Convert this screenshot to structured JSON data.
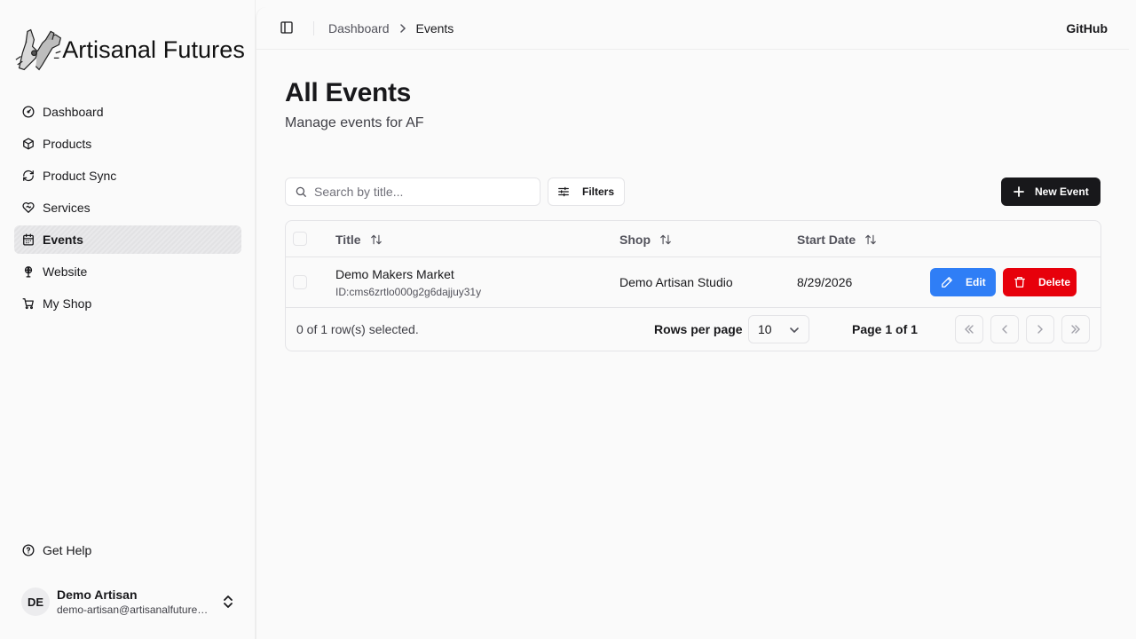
{
  "app": {
    "brand": "Artisanal Futures"
  },
  "sidebar": {
    "items": [
      {
        "label": "Dashboard",
        "icon": "gauge-icon"
      },
      {
        "label": "Products",
        "icon": "package-icon"
      },
      {
        "label": "Product Sync",
        "icon": "refresh-icon"
      },
      {
        "label": "Services",
        "icon": "heart-handshake-icon"
      },
      {
        "label": "Events",
        "icon": "calendar-icon",
        "active": true
      },
      {
        "label": "Website",
        "icon": "globe-pin-icon"
      },
      {
        "label": "My Shop",
        "icon": "cart-icon"
      }
    ],
    "help": {
      "label": "Get Help",
      "icon": "help-circle-icon"
    },
    "user": {
      "initials": "DE",
      "name": "Demo Artisan",
      "email": "demo-artisan@artisanalfutures.org"
    }
  },
  "header": {
    "breadcrumbs": [
      "Dashboard",
      "Events"
    ],
    "github_label": "GitHub"
  },
  "page": {
    "title": "All Events",
    "subtitle": "Manage events for AF"
  },
  "toolbar": {
    "search_placeholder": "Search by title...",
    "search_value": "",
    "filters_label": "Filters",
    "new_event_label": "New Event"
  },
  "table": {
    "columns": [
      "Title",
      "Shop",
      "Start Date"
    ],
    "rows": [
      {
        "title": "Demo Makers Market",
        "id": "ID:cms6zrtlo000g2g6dajjuy31y",
        "shop": "Demo Artisan Studio",
        "start_date": "8/29/2026",
        "edit_label": "Edit",
        "delete_label": "Delete"
      }
    ],
    "footer": {
      "selected_text": "0 of 1 row(s) selected.",
      "rows_per_page_label": "Rows per page",
      "rows_per_page_value": "10",
      "page_info": "Page 1 of 1"
    }
  },
  "colors": {
    "accent": "#18181b",
    "edit": "#2f7ef6",
    "delete": "#e7000b"
  }
}
